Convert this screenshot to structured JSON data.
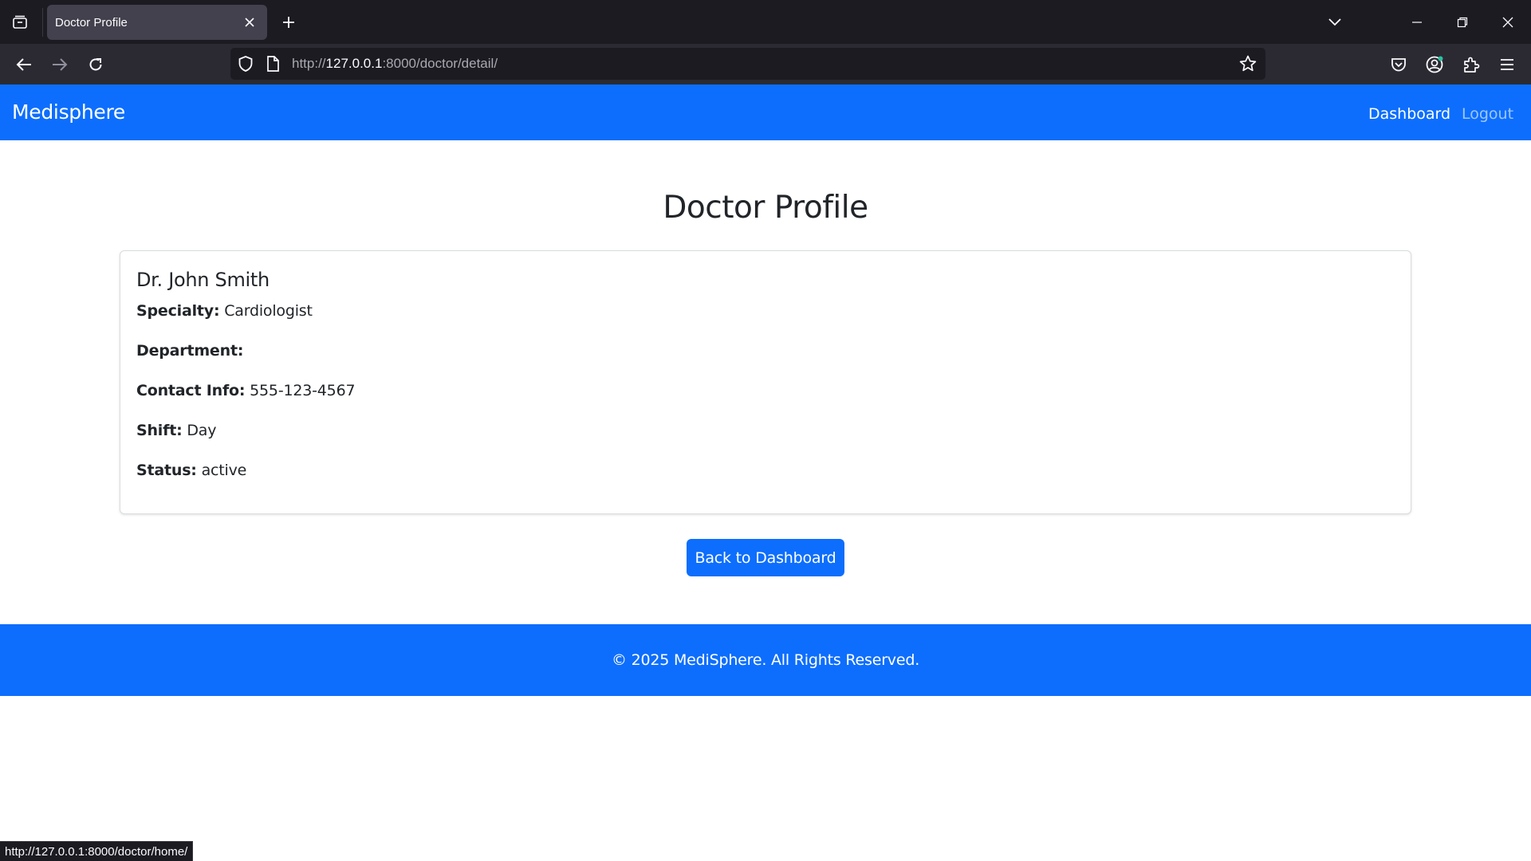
{
  "browser": {
    "tab_title": "Doctor Profile",
    "url_prefix": "http://",
    "url_host": "127.0.0.1",
    "url_rest": ":8000/doctor/detail/",
    "status_url": "http://127.0.0.1:8000/doctor/home/"
  },
  "site_nav": {
    "brand": "Medisphere",
    "links": [
      {
        "label": "Dashboard"
      },
      {
        "label": "Logout"
      }
    ]
  },
  "page": {
    "title": "Doctor Profile"
  },
  "doctor": {
    "name": "Dr. John Smith",
    "fields": [
      {
        "label": "Specialty:",
        "value": "Cardiologist"
      },
      {
        "label": "Department:",
        "value": ""
      },
      {
        "label": "Contact Info:",
        "value": "555-123-4567"
      },
      {
        "label": "Shift:",
        "value": "Day"
      },
      {
        "label": "Status:",
        "value": "active"
      }
    ]
  },
  "actions": {
    "back_label": "Back to Dashboard"
  },
  "footer": {
    "text": "© 2025 MediSphere. All Rights Reserved."
  },
  "colors": {
    "primary": "#0d6efd",
    "chrome_dark": "#1c1b22",
    "chrome_toolbar": "#2b2a33",
    "tab_active": "#42414d"
  }
}
